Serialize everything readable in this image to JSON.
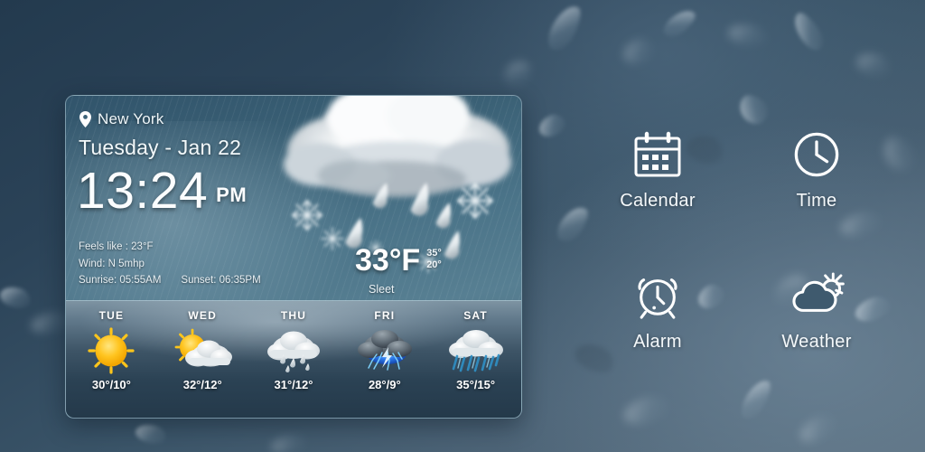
{
  "background": {
    "top_color": "#294156",
    "bottom_color": "#556b7d"
  },
  "widget": {
    "location": {
      "icon": "map-pin-icon",
      "name": "New York"
    },
    "date": "Tuesday - Jan 22",
    "clock": {
      "time": "13:24",
      "meridiem": "PM"
    },
    "details": {
      "feels_like": "Feels like : 23°F",
      "wind": "Wind: N 5mhp",
      "sunrise": "Sunrise: 05:55AM",
      "sunset": "Sunset: 06:35PM"
    },
    "current": {
      "temperature": "33°F",
      "high": "35°",
      "low": "20°",
      "condition": "Sleet",
      "icon": "sleet-icon"
    },
    "forecast": [
      {
        "day": "TUE",
        "icon": "sunny-icon",
        "temps": "30°/10°",
        "high": "30°",
        "low": "10°"
      },
      {
        "day": "WED",
        "icon": "partly-cloudy-icon",
        "temps": "32°/12°",
        "high": "32°",
        "low": "12°"
      },
      {
        "day": "THU",
        "icon": "rain-icon",
        "temps": "31°/12°",
        "high": "31°",
        "low": "12°"
      },
      {
        "day": "FRI",
        "icon": "thunderstorm-icon",
        "temps": "28°/9°",
        "high": "28°",
        "low": "9°"
      },
      {
        "day": "SAT",
        "icon": "showers-icon",
        "temps": "35°/15°",
        "high": "35°",
        "low": "15°"
      }
    ]
  },
  "shortcuts": [
    {
      "label": "Calendar",
      "icon": "calendar-icon"
    },
    {
      "label": "Time",
      "icon": "clock-icon"
    },
    {
      "label": "Alarm",
      "icon": "alarm-clock-icon"
    },
    {
      "label": "Weather",
      "icon": "cloud-sun-icon"
    }
  ]
}
